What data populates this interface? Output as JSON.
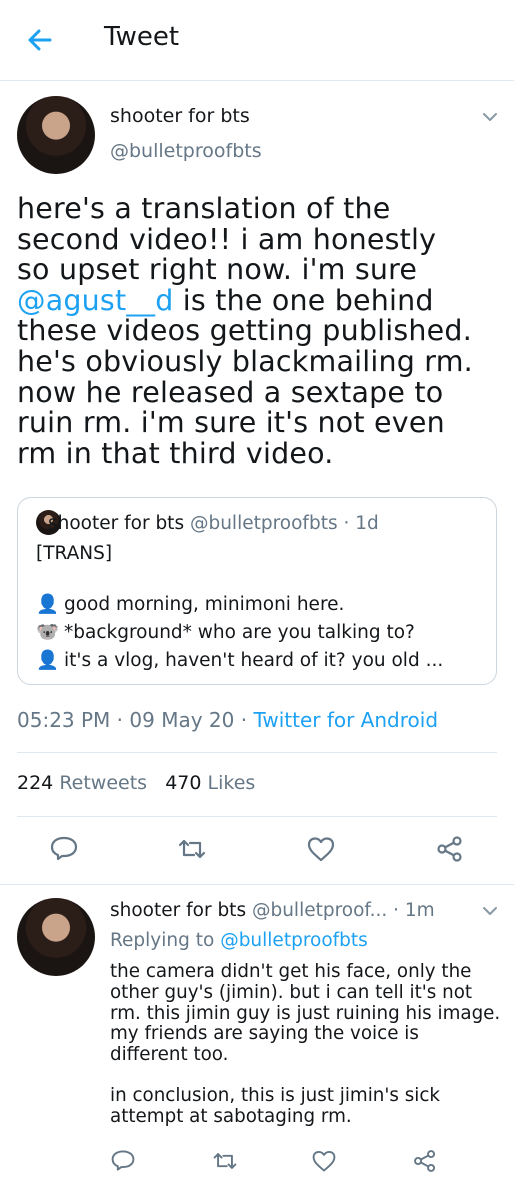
{
  "header": {
    "title": "Tweet"
  },
  "tweet": {
    "author_name": "shooter for bts",
    "author_handle": "@bulletproofbts",
    "text_lines": [
      "here's a translation of the",
      "second video!! i am honestly",
      "so upset right now. i'm sure",
      " is the one behind",
      "these videos getting published.",
      "he's obviously blackmailing rm.",
      "now he released a sextape to",
      "ruin rm. i'm sure it's not even",
      "rm in that third video."
    ],
    "mention": "@agust__d",
    "quoted": {
      "author_name": "shooter for bts",
      "author_handle": "@bulletproofbts · 1d",
      "lines": [
        "[TRANS]",
        "good morning, minimoni here.",
        "*background* who are you talking to?",
        "it's a vlog, haven't heard of it? you old ..."
      ],
      "emojis": [
        "👤",
        "🐨",
        "👤"
      ]
    },
    "time": "05:23 PM",
    "date": "09 May 20",
    "source": "Twitter for Android",
    "sep": " · ",
    "retweets_count": "224",
    "retweets_label": "Retweets",
    "likes_count": "470",
    "likes_label": "Likes"
  },
  "reply": {
    "author_name": "shooter for bts",
    "author_handle": "@bulletproof...",
    "time": "· 1m",
    "replying_prefix": "Replying to ",
    "replying_handle": "@bulletproofbts",
    "paragraph1": "the camera didn't get his face, only the other guy's (jimin). but i can tell it's not rm. this jimin guy is just ruining his image. my friends are saying the voice is different too.",
    "paragraph2": "in conclusion, this is just jimin's sick attempt at sabotaging rm."
  },
  "colors": {
    "accent": "#1da1f2",
    "muted": "#657786",
    "text": "#14171a",
    "border": "#e1e8ed"
  },
  "icons": [
    "back-arrow-icon",
    "chevron-down-icon",
    "reply-icon",
    "retweet-icon",
    "like-icon",
    "share-icon"
  ]
}
